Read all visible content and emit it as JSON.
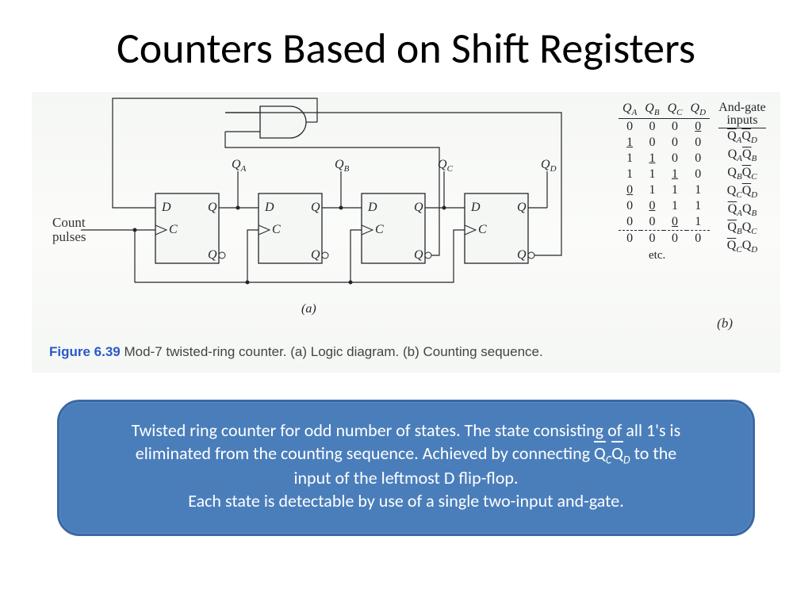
{
  "title": "Counters Based on Shift Registers",
  "figure": {
    "count_label_1": "Count",
    "count_label_2": "pulses",
    "q_labels": [
      "Q_A",
      "Q_B",
      "Q_C",
      "Q_D"
    ],
    "ff_pins": {
      "d": "D",
      "q": "Q",
      "c": "C",
      "qbar": "Q"
    },
    "sub_a": "(a)",
    "sub_b": "(b)",
    "caption_num": "Figure 6.39",
    "caption_text": "  Mod-7 twisted-ring counter. (a) Logic diagram. (b) Counting sequence."
  },
  "table": {
    "header_qa": "Q",
    "header_qb": "Q",
    "header_qc": "Q",
    "header_qd": "Q",
    "sub_a": "A",
    "sub_b": "B",
    "sub_c": "C",
    "sub_d": "D",
    "gate_header_1": "And-gate",
    "gate_header_2": "inputs",
    "rows": [
      [
        "0",
        "0",
        "0",
        "0"
      ],
      [
        "1",
        "0",
        "0",
        "0"
      ],
      [
        "1",
        "1",
        "0",
        "0"
      ],
      [
        "1",
        "1",
        "1",
        "0"
      ],
      [
        "0",
        "1",
        "1",
        "1"
      ],
      [
        "0",
        "0",
        "1",
        "1"
      ],
      [
        "0",
        "0",
        "0",
        "1"
      ],
      [
        "0",
        "0",
        "0",
        "0"
      ]
    ],
    "gate_rows": [
      {
        "l": "Q",
        "ls": "A",
        "lo": true,
        "r": "Q",
        "rs": "D",
        "ro": true
      },
      {
        "l": "Q",
        "ls": "A",
        "lo": false,
        "r": "Q",
        "rs": "B",
        "ro": true
      },
      {
        "l": "Q",
        "ls": "B",
        "lo": false,
        "r": "Q",
        "rs": "C",
        "ro": true
      },
      {
        "l": "Q",
        "ls": "C",
        "lo": false,
        "r": "Q",
        "rs": "D",
        "ro": true
      },
      {
        "l": "Q",
        "ls": "A",
        "lo": true,
        "r": "Q",
        "rs": "B",
        "ro": false
      },
      {
        "l": "Q",
        "ls": "B",
        "lo": true,
        "r": "Q",
        "rs": "C",
        "ro": false
      },
      {
        "l": "Q",
        "ls": "C",
        "lo": true,
        "r": "Q",
        "rs": "D",
        "ro": false
      }
    ],
    "etc": "etc."
  },
  "explain": {
    "line1a": "Twisted ring counter for odd number of states.  The state consisting of all 1's is",
    "line2a": "eliminated from the counting sequence.  Achieved by connecting ",
    "formula_qc": "Q",
    "formula_qc_sub": "C",
    "formula_qd": "Q",
    "formula_qd_sub": "D",
    "line2b": " to the",
    "line3": "input of the leftmost D flip-flop.",
    "line4": "Each state is detectable by use of a single two-input and-gate."
  }
}
